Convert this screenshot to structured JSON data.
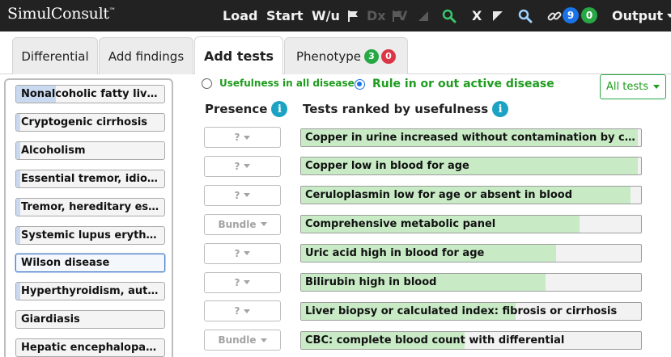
{
  "app": {
    "logo": "SimulConsult",
    "logo_mark": "™"
  },
  "topnav": {
    "load": "Load",
    "start": "Start",
    "wu": "W/u",
    "dx": "Dx",
    "v": "V",
    "x": "X",
    "links_badge_blue": "9",
    "links_badge_green": "0",
    "output": "Output"
  },
  "tabs": [
    {
      "label": "Differential"
    },
    {
      "label": "Add findings"
    },
    {
      "label": "Add tests"
    },
    {
      "label": "Phenotype",
      "badge_green": "3",
      "badge_red": "0"
    }
  ],
  "colors": {
    "accent_green": "#1e9c1e",
    "badge_blue": "#1a73e8",
    "badge_green": "#28a745",
    "badge_red": "#dc3545",
    "bar_fill": "#c8ebc6",
    "dx_fill": "#c9d9f0"
  },
  "diagnoses": [
    {
      "label": "Nonalcoholic fatty live...",
      "level": 0.27,
      "selected": false
    },
    {
      "label": "Cryptogenic cirrhosis",
      "level": 0.03,
      "selected": false
    },
    {
      "label": "Alcoholism",
      "level": 0.03,
      "selected": false
    },
    {
      "label": "Essential tremor, idiop...",
      "level": 0.03,
      "selected": false
    },
    {
      "label": "Tremor, hereditary esse...",
      "level": 0.03,
      "selected": false
    },
    {
      "label": "Systemic lupus erythe...",
      "level": 0.03,
      "selected": false
    },
    {
      "label": "Wilson disease",
      "level": 0.0,
      "selected": true
    },
    {
      "label": "Hyperthyroidism, autoi...",
      "level": 0.03,
      "selected": false
    },
    {
      "label": "Giardiasis",
      "level": 0.0,
      "selected": false
    },
    {
      "label": "Hepatic encephalopathy",
      "level": 0.0,
      "selected": false
    }
  ],
  "mode": {
    "option_all": "Usefulness in all diseases",
    "option_active": "Rule in or out active disease",
    "selected": "active"
  },
  "filter": {
    "label": "All tests"
  },
  "headers": {
    "presence": "Presence",
    "ranked": "Tests ranked by usefulness",
    "info_glyph": "i"
  },
  "tests": [
    {
      "presence": "?",
      "label": "Copper in urine increased without contamination by coppe...",
      "usefulness": 0.99
    },
    {
      "presence": "?",
      "label": "Copper low in blood for age",
      "usefulness": 0.99
    },
    {
      "presence": "?",
      "label": "Ceruloplasmin low for age or absent in blood",
      "usefulness": 0.97
    },
    {
      "presence": "Bundle",
      "label": "Comprehensive metabolic panel",
      "usefulness": 0.82
    },
    {
      "presence": "?",
      "label": "Uric acid high in blood for age",
      "usefulness": 0.75
    },
    {
      "presence": "?",
      "label": "Bilirubin high in blood",
      "usefulness": 0.72
    },
    {
      "presence": "?",
      "label": "Liver biopsy or calculated index: fibrosis or cirrhosis",
      "usefulness": 0.63
    },
    {
      "presence": "Bundle",
      "label": "CBC: complete blood count with differential",
      "usefulness": 0.48
    }
  ]
}
